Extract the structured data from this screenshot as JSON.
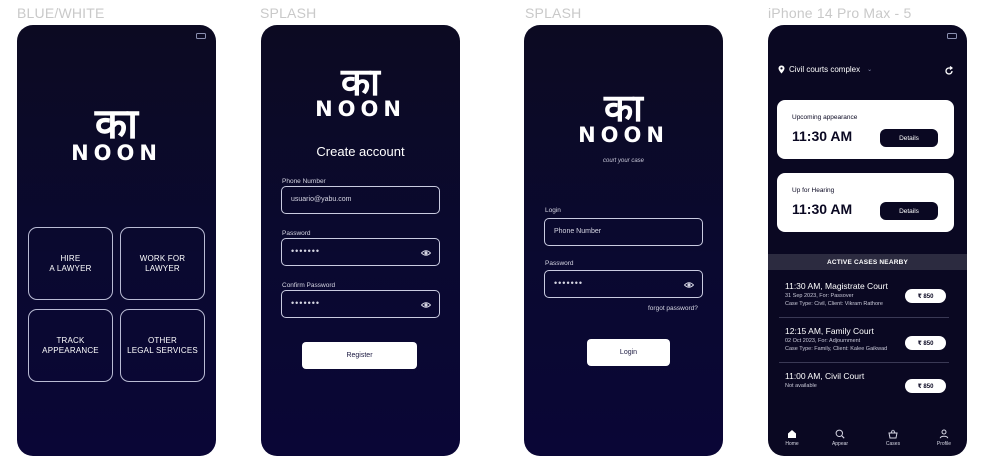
{
  "frames": [
    {
      "label": "BLUE/WHITE"
    },
    {
      "label": "SPLASH"
    },
    {
      "label": "SPLASH"
    },
    {
      "label": "iPhone 14 Pro Max - 5"
    }
  ],
  "brand": {
    "devanagari": "का",
    "wordmark": "NOON",
    "tagline": "court your case"
  },
  "home": {
    "services": [
      {
        "label": "HIRE\nA LAWYER"
      },
      {
        "label": "WORK FOR\nLAWYER"
      },
      {
        "label": "TRACK\nAPPEARANCE"
      },
      {
        "label": "OTHER\nLEGAL SERVICES"
      }
    ]
  },
  "register": {
    "title": "Create account",
    "phone_label": "Phone Number",
    "phone_value": "usuario@yabu.com",
    "password_label": "Password",
    "password_value": "•••••••",
    "confirm_label": "Confirm Password",
    "confirm_value": "•••••••",
    "button": "Register"
  },
  "login": {
    "login_label": "Login",
    "phone_placeholder": "Phone Number",
    "password_label": "Password",
    "password_value": "•••••••",
    "forgot": "forgot password?",
    "button": "Login"
  },
  "dashboard": {
    "location": "Civil courts complex",
    "cards": [
      {
        "label": "Upcoming appearance",
        "time": "11:30 AM",
        "button": "Details"
      },
      {
        "label": "Up for Hearing",
        "time": "11:30 AM",
        "button": "Details"
      }
    ],
    "section_title": "ACTIVE CASES NEARBY",
    "cases": [
      {
        "title": "11:30 AM, Magistrate Court",
        "sub": "31 Sep 2023, For: Passover",
        "detail": "Case Type: Civil, Client: Vikram Rathore",
        "fee": "₹ 850"
      },
      {
        "title": "12:15 AM, Family Court",
        "sub": "02 Oct 2023, For: Adjournment",
        "detail": "Case Type: Family, Client: Kalee Gaikwad",
        "fee": "₹ 850"
      },
      {
        "title": "11:00 AM, Civil Court",
        "sub": "Not available",
        "detail": "",
        "fee": "₹ 850"
      }
    ],
    "nav": [
      {
        "label": "Home",
        "icon": "home-icon"
      },
      {
        "label": "Appear",
        "icon": "search-icon"
      },
      {
        "label": "Cases",
        "icon": "basket-icon"
      },
      {
        "label": "Profile",
        "icon": "user-icon"
      }
    ]
  }
}
